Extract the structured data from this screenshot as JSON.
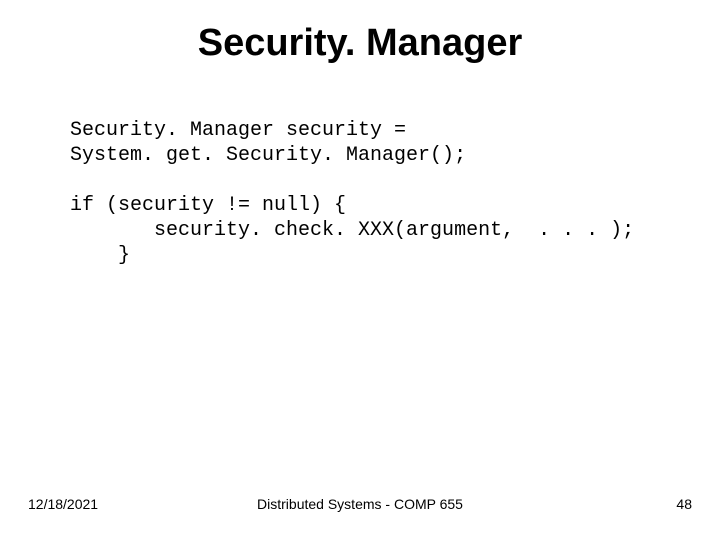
{
  "title": "Security. Manager",
  "code": {
    "line1": "Security. Manager security =",
    "line2": "System. get. Security. Manager();",
    "line3": "",
    "line4": "if (security != null) {",
    "line5": "       security. check. XXX(argument,  . . . );",
    "line6": "    }"
  },
  "footer": {
    "date": "12/18/2021",
    "center": "Distributed Systems - COMP 655",
    "page": "48"
  }
}
